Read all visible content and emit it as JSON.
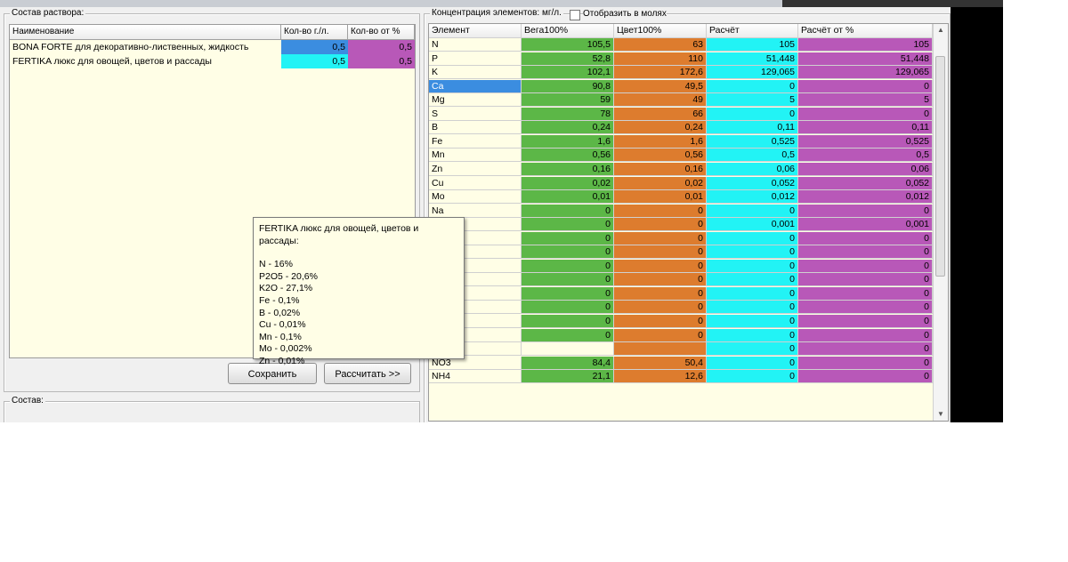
{
  "left_panel": {
    "group_label": "Состав раствора:",
    "columns": [
      "Наименование",
      "Кол-во г./л.",
      "Кол-во от %"
    ],
    "rows": [
      {
        "name": "BONA FORTE для декоративно-лиственных, жидкость",
        "qty": "0,5",
        "pct": "0,5"
      },
      {
        "name": "FERTIKA люкс для овощей, цветов и рассады",
        "qty": "0,5",
        "pct": "0,5"
      }
    ],
    "save_label": "Сохранить",
    "calc_label": "Рассчитать >>",
    "bottom_group_label": "Состав:"
  },
  "right_panel": {
    "group_label": "Концентрация элементов: мг/л.",
    "checkbox_label": "Отобразить в молях",
    "columns": [
      "Элемент",
      "Вега100%",
      "Цвет100%",
      "Расчёт",
      "Расчёт от %"
    ],
    "rows": [
      {
        "el": "N",
        "v": "105,5",
        "c": "63",
        "r": "105",
        "p": "105"
      },
      {
        "el": "P",
        "v": "52,8",
        "c": "110",
        "r": "51,448",
        "p": "51,448"
      },
      {
        "el": "K",
        "v": "102,1",
        "c": "172,6",
        "r": "129,065",
        "p": "129,065"
      },
      {
        "el": "Ca",
        "v": "90,8",
        "c": "49,5",
        "r": "0",
        "p": "0"
      },
      {
        "el": "Mg",
        "v": "59",
        "c": "49",
        "r": "5",
        "p": "5"
      },
      {
        "el": "S",
        "v": "78",
        "c": "66",
        "r": "0",
        "p": "0"
      },
      {
        "el": "B",
        "v": "0,24",
        "c": "0,24",
        "r": "0,11",
        "p": "0,11"
      },
      {
        "el": "Fe",
        "v": "1,6",
        "c": "1,6",
        "r": "0,525",
        "p": "0,525"
      },
      {
        "el": "Mn",
        "v": "0,56",
        "c": "0,56",
        "r": "0,5",
        "p": "0,5"
      },
      {
        "el": "Zn",
        "v": "0,16",
        "c": "0,16",
        "r": "0,06",
        "p": "0,06"
      },
      {
        "el": "Cu",
        "v": "0,02",
        "c": "0,02",
        "r": "0,052",
        "p": "0,052"
      },
      {
        "el": "Mo",
        "v": "0,01",
        "c": "0,01",
        "r": "0,012",
        "p": "0,012"
      },
      {
        "el": "Na",
        "v": "0",
        "c": "0",
        "r": "0",
        "p": "0"
      },
      {
        "el": "",
        "v": "0",
        "c": "0",
        "r": "0,001",
        "p": "0,001"
      },
      {
        "el": "",
        "v": "0",
        "c": "0",
        "r": "0",
        "p": "0"
      },
      {
        "el": "",
        "v": "0",
        "c": "0",
        "r": "0",
        "p": "0"
      },
      {
        "el": "",
        "v": "0",
        "c": "0",
        "r": "0",
        "p": "0"
      },
      {
        "el": "",
        "v": "0",
        "c": "0",
        "r": "0",
        "p": "0"
      },
      {
        "el": "",
        "v": "0",
        "c": "0",
        "r": "0",
        "p": "0"
      },
      {
        "el": "",
        "v": "0",
        "c": "0",
        "r": "0",
        "p": "0"
      },
      {
        "el": "",
        "v": "0",
        "c": "0",
        "r": "0",
        "p": "0"
      },
      {
        "el": "",
        "v": "0",
        "c": "0",
        "r": "0",
        "p": "0"
      },
      {
        "el": "",
        "v": "",
        "c": "",
        "r": "0",
        "p": "0"
      },
      {
        "el": "NO3",
        "v": "84,4",
        "c": "50,4",
        "r": "0",
        "p": "0"
      },
      {
        "el": "NH4",
        "v": "21,1",
        "c": "12,6",
        "r": "0",
        "p": "0"
      }
    ]
  },
  "tooltip": {
    "title": "FERTIKA люкс для овощей, цветов и рассады:",
    "lines": [
      "N - 16%",
      "P2O5 - 20,6%",
      "K2O - 27,1%",
      "Fe - 0,1%",
      "B - 0,02%",
      "Cu - 0,01%",
      "Mn - 0,1%",
      "Mo - 0,002%",
      "Zn - 0,01%"
    ]
  },
  "colors": {
    "vega": "#5cb747",
    "tsvet": "#dd7c2e",
    "raschet": "#22f3f5",
    "raschet_pct": "#b858b8",
    "qty_cell": "#3b8de0",
    "qty_cell2": "#22f3f5",
    "pct_cell": "#b858b8",
    "selected": "#3b8de0",
    "grid_bg": "#fffee6"
  }
}
